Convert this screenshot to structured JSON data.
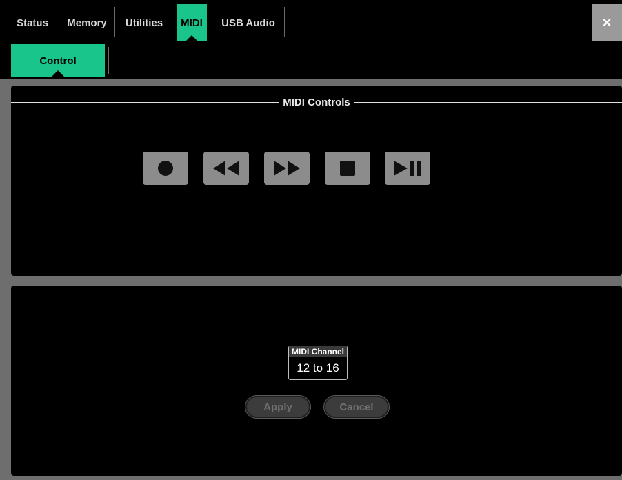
{
  "tabs": [
    {
      "label": "Status",
      "active": false
    },
    {
      "label": "Memory",
      "active": false
    },
    {
      "label": "Utilities",
      "active": false
    },
    {
      "label": "MIDI",
      "active": true
    },
    {
      "label": "USB Audio",
      "active": false
    }
  ],
  "close": {
    "label": "×"
  },
  "subtabs": [
    {
      "label": "Control",
      "active": true
    }
  ],
  "midi_controls": {
    "title": "MIDI Controls",
    "buttons": [
      {
        "icon": "record-icon"
      },
      {
        "icon": "rewind-icon"
      },
      {
        "icon": "fast-forward-icon"
      },
      {
        "icon": "stop-icon"
      },
      {
        "icon": "play-pause-icon"
      }
    ]
  },
  "midi_channel": {
    "label": "MIDI Channel",
    "value": "12 to 16"
  },
  "actions": {
    "apply_label": "Apply",
    "cancel_label": "Cancel"
  },
  "colors": {
    "accent": "#19c58a",
    "frame": "#6e6e6e",
    "button": "#8c8c8c"
  }
}
